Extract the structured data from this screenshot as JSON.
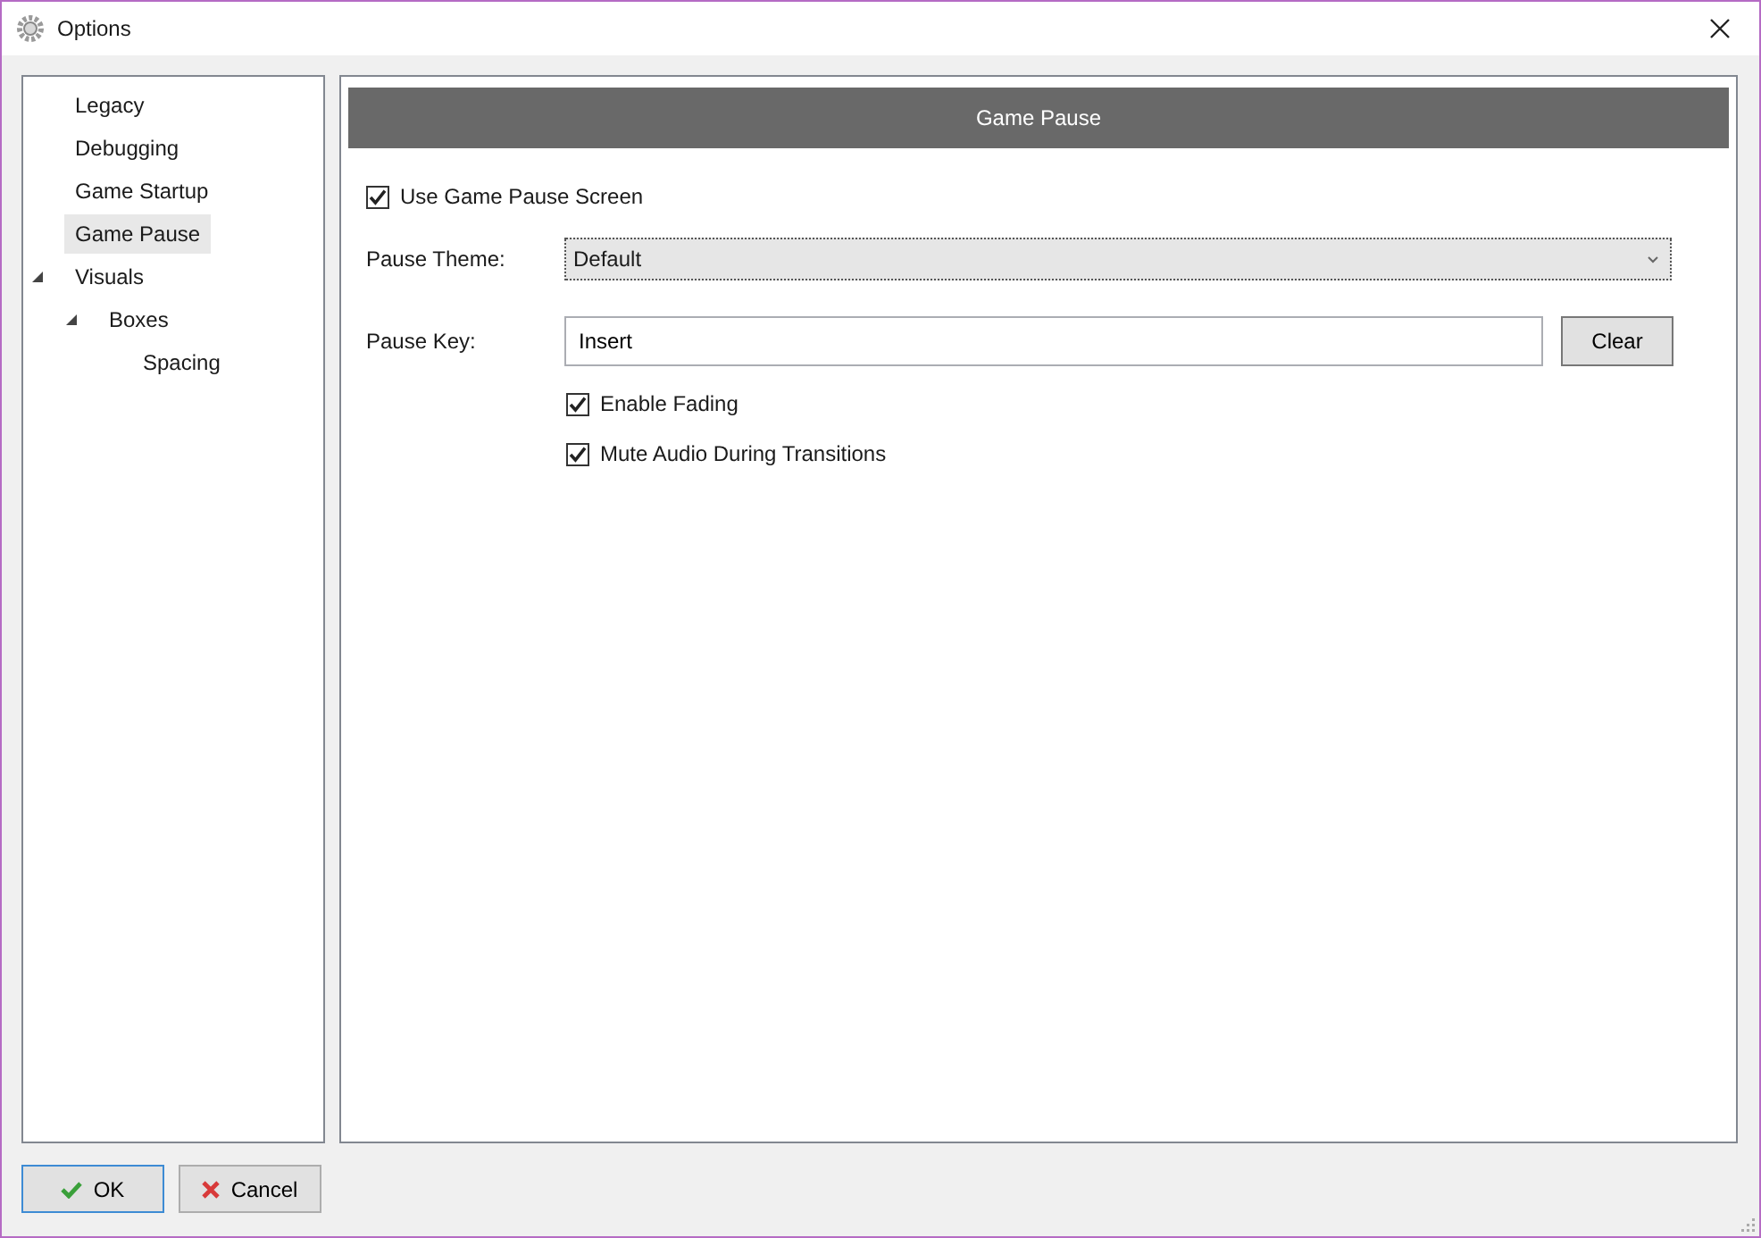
{
  "window": {
    "title": "Options"
  },
  "tree": [
    {
      "label": "Legacy",
      "selected": false
    },
    {
      "label": "Debugging",
      "selected": false
    },
    {
      "label": "Game Startup",
      "selected": false
    },
    {
      "label": "Game Pause",
      "selected": true
    },
    {
      "label": "Visuals",
      "selected": false,
      "expanded": true,
      "children": [
        {
          "label": "Boxes",
          "selected": false,
          "expanded": true,
          "children": [
            {
              "label": "Spacing",
              "selected": false
            }
          ]
        }
      ]
    }
  ],
  "panel": {
    "header": "Game Pause",
    "use_screen": {
      "label": "Use Game Pause Screen",
      "checked": true
    },
    "theme": {
      "label": "Pause Theme:",
      "value": "Default"
    },
    "key": {
      "label": "Pause Key:",
      "value": "Insert",
      "button": "Clear"
    },
    "options": [
      {
        "label": "Enable Fading",
        "checked": true
      },
      {
        "label": "Mute Audio During Transitions",
        "checked": true
      }
    ]
  },
  "buttons": [
    {
      "kind": "ok",
      "label": "OK"
    },
    {
      "kind": "cancel",
      "label": "Cancel"
    }
  ]
}
